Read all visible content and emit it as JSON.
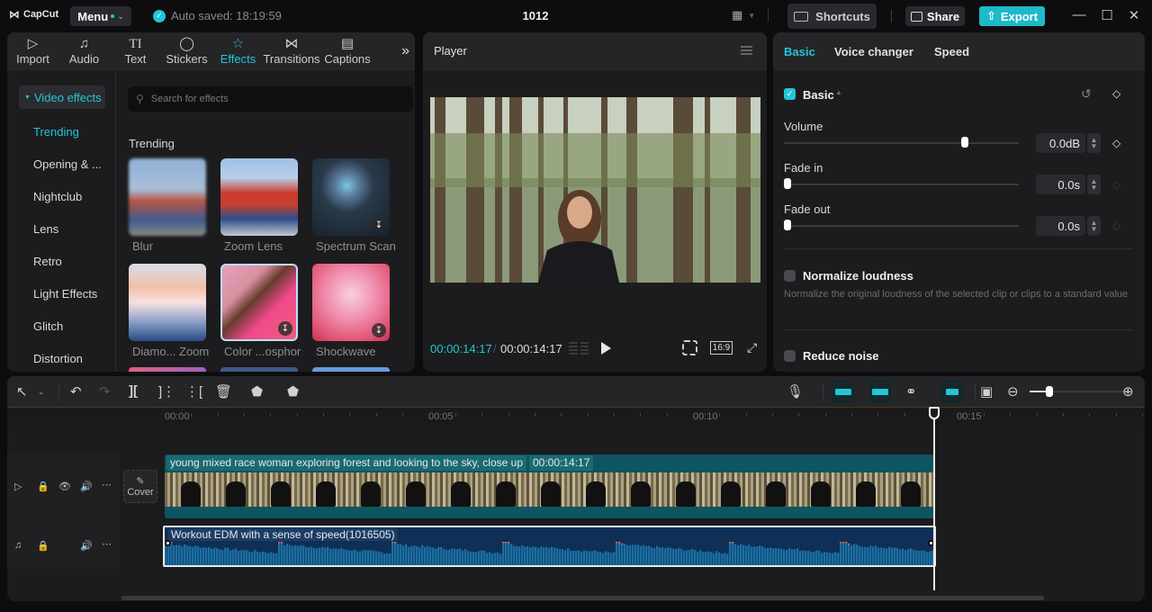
{
  "titlebar": {
    "app_name": "CapCut",
    "menu_label": "Menu",
    "autosave_text": "Auto saved: 18:19:59",
    "project_title": "1012",
    "shortcuts_label": "Shortcuts",
    "share_label": "Share",
    "export_label": "Export",
    "accent_color": "#22c7d4"
  },
  "media": {
    "tabs": [
      {
        "label": "Import",
        "icon": "import-icon"
      },
      {
        "label": "Audio",
        "icon": "audio-icon"
      },
      {
        "label": "Text",
        "icon": "text-icon"
      },
      {
        "label": "Stickers",
        "icon": "stickers-icon"
      },
      {
        "label": "Effects",
        "icon": "effects-icon",
        "active": true
      },
      {
        "label": "Transitions",
        "icon": "transitions-icon"
      },
      {
        "label": "Captions",
        "icon": "captions-icon"
      }
    ],
    "category_label": "Video effects",
    "sidebar_items": [
      "Trending",
      "Opening & ...",
      "Nightclub",
      "Lens",
      "Retro",
      "Light Effects",
      "Glitch",
      "Distortion"
    ],
    "search_placeholder": "Search for effects",
    "section_title": "Trending",
    "effects": [
      {
        "label": "Blur",
        "downloadable": false
      },
      {
        "label": "Zoom Lens",
        "downloadable": false
      },
      {
        "label": "Spectrum Scan",
        "downloadable": true
      },
      {
        "label": "Diamo... Zoom",
        "downloadable": false
      },
      {
        "label": "Color ...osphor",
        "downloadable": true
      },
      {
        "label": "Shockwave",
        "downloadable": true
      }
    ]
  },
  "player": {
    "title": "Player",
    "current_time": "00:00:14:17",
    "duration": "00:00:14:17",
    "ratio_label": "16:9"
  },
  "props": {
    "tabs": [
      "Basic",
      "Voice changer",
      "Speed"
    ],
    "active_tab": "Basic",
    "section_title": "Basic",
    "section_enabled": true,
    "volume": {
      "label": "Volume",
      "value": "0.0dB",
      "slider_fraction": 0.78
    },
    "fade_in": {
      "label": "Fade in",
      "value": "0.0s",
      "slider_fraction": 0.0
    },
    "fade_out": {
      "label": "Fade out",
      "value": "0.0s",
      "slider_fraction": 0.0
    },
    "normalize": {
      "label": "Normalize loudness",
      "enabled": false,
      "description": "Normalize the original loudness of the selected clip or clips to a standard value"
    },
    "reduce_noise": {
      "label": "Reduce noise",
      "enabled": false
    }
  },
  "timeline": {
    "ruler_labels": [
      "00:00",
      "00:05",
      "00:10",
      "00:15"
    ],
    "zoom_fraction": 0.18,
    "video_clip": {
      "title": "young mixed race woman exploring forest and looking to the sky, close up",
      "duration": "00:00:14:17"
    },
    "audio_clip": {
      "title": "Workout EDM with a sense of speed(1016505)"
    },
    "cover_label": "Cover"
  }
}
